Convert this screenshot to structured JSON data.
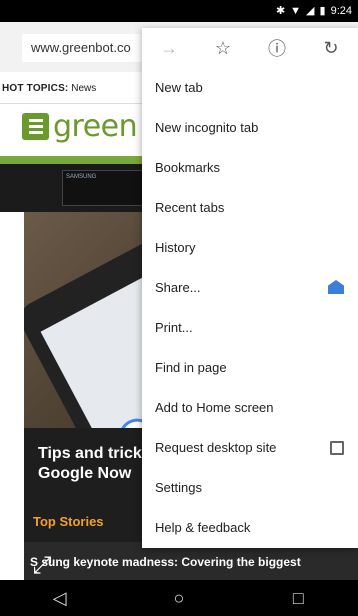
{
  "status_bar": {
    "time": "9:24",
    "bluetooth_icon": "bluetooth-icon",
    "wifi_icon": "wifi-icon",
    "signal_icon": "signal-icon",
    "battery_icon": "battery-icon"
  },
  "toolbar": {
    "url": "www.greenbot.co"
  },
  "page": {
    "hot_topics_label": "HOT TOPICS:",
    "hot_topics_first": "News",
    "logo_text": "green",
    "ad_text": "SAMSUNG",
    "ad_partial_letter": "C",
    "article_title": "Tips and trick\nGoogle Now",
    "top_stories_label": "Top Stories",
    "headline": "Samsung keynote madness: Covering the biggest",
    "headline_visible": "S  sung keynote madness: Covering the biggest"
  },
  "menu": {
    "icons": [
      "forward-icon",
      "star-icon",
      "info-icon",
      "refresh-icon"
    ],
    "items": [
      {
        "label": "New tab"
      },
      {
        "label": "New incognito tab"
      },
      {
        "label": "Bookmarks"
      },
      {
        "label": "Recent tabs"
      },
      {
        "label": "History"
      },
      {
        "label": "Share..."
      },
      {
        "label": "Print..."
      },
      {
        "label": "Find in page"
      },
      {
        "label": "Add to Home screen"
      },
      {
        "label": "Request desktop site"
      },
      {
        "label": "Settings"
      },
      {
        "label": "Help & feedback"
      }
    ]
  },
  "nav_bar": {
    "back_icon": "back-icon",
    "home_icon": "home-icon",
    "recents_icon": "recents-icon"
  },
  "colors": {
    "brand_green": "#6a9a2c",
    "accent_orange": "#f0a030",
    "share_blue": "#3b7fd8"
  }
}
